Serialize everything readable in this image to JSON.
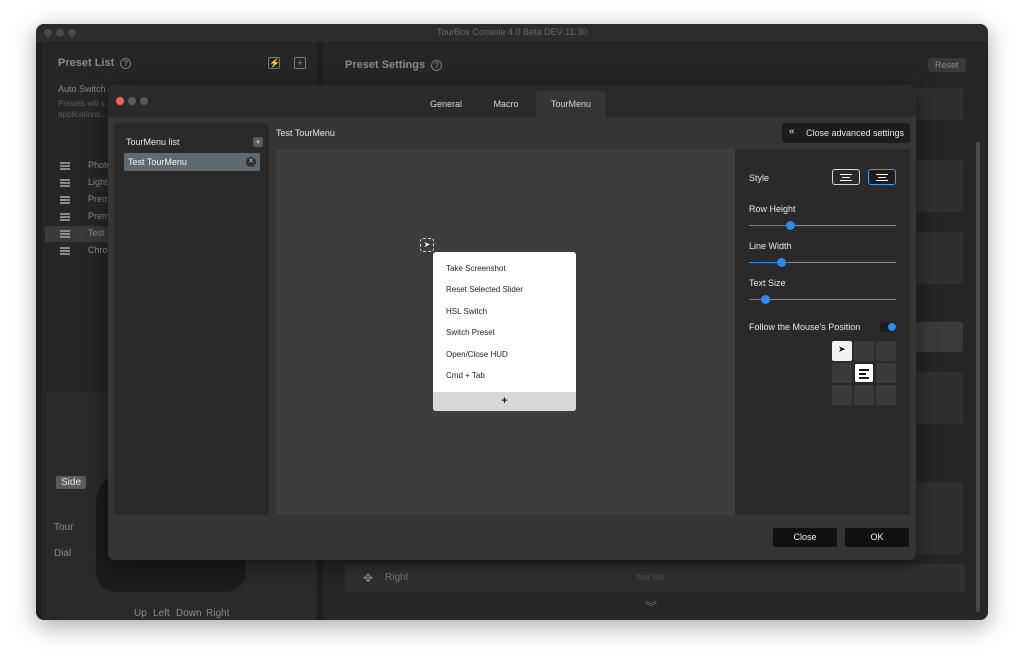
{
  "window": {
    "title": "TourBox Console 4.0 Beta DEV 11.30"
  },
  "left_panel": {
    "title": "Preset List",
    "help_icon": "?",
    "flash_icon": "⚡",
    "add_icon": "+",
    "auto_switch": "Auto Switch",
    "auto_switch_desc": "Presets will s... applications...",
    "presets": [
      {
        "label": "Photo"
      },
      {
        "label": "Lightr"
      },
      {
        "label": "Premi"
      },
      {
        "label": "Premi"
      },
      {
        "label": "Test"
      },
      {
        "label": "Chron"
      }
    ]
  },
  "device": {
    "side": "Side",
    "tour": "Tour",
    "dial": "Dial",
    "up": "Up",
    "left": "Left",
    "down": "Down",
    "right": "Right"
  },
  "right_panel": {
    "title": "Preset Settings",
    "help_icon": "?",
    "reset": "Reset",
    "right_label": "Right",
    "not_set": "Not Set"
  },
  "modal": {
    "tabs": [
      "General",
      "Macro",
      "TourMenu"
    ],
    "active_tab": "TourMenu",
    "list_title": "TourMenu list",
    "list_add": "+",
    "list_items": [
      {
        "label": "Test TourMenu",
        "remove": "✕"
      }
    ],
    "selected_name": "Test TourMenu",
    "close_advanced": "Close advanced settings",
    "close_advanced_icon": "«",
    "menu_items": [
      "Take Screenshot",
      "Reset Selected Slider",
      "HSL Switch",
      "Switch Preset",
      "Open/Close HUD",
      "Cmd + Tab"
    ],
    "menu_add": "+",
    "settings": {
      "style_label": "Style",
      "row_height_label": "Row Height",
      "row_height_value": 0.28,
      "line_width_label": "Line Width",
      "line_width_value": 0.22,
      "text_size_label": "Text Size",
      "text_size_value": 0.11,
      "follow_label": "Follow the Mouse's Position",
      "follow_enabled": true
    },
    "close": "Close",
    "ok": "OK"
  }
}
